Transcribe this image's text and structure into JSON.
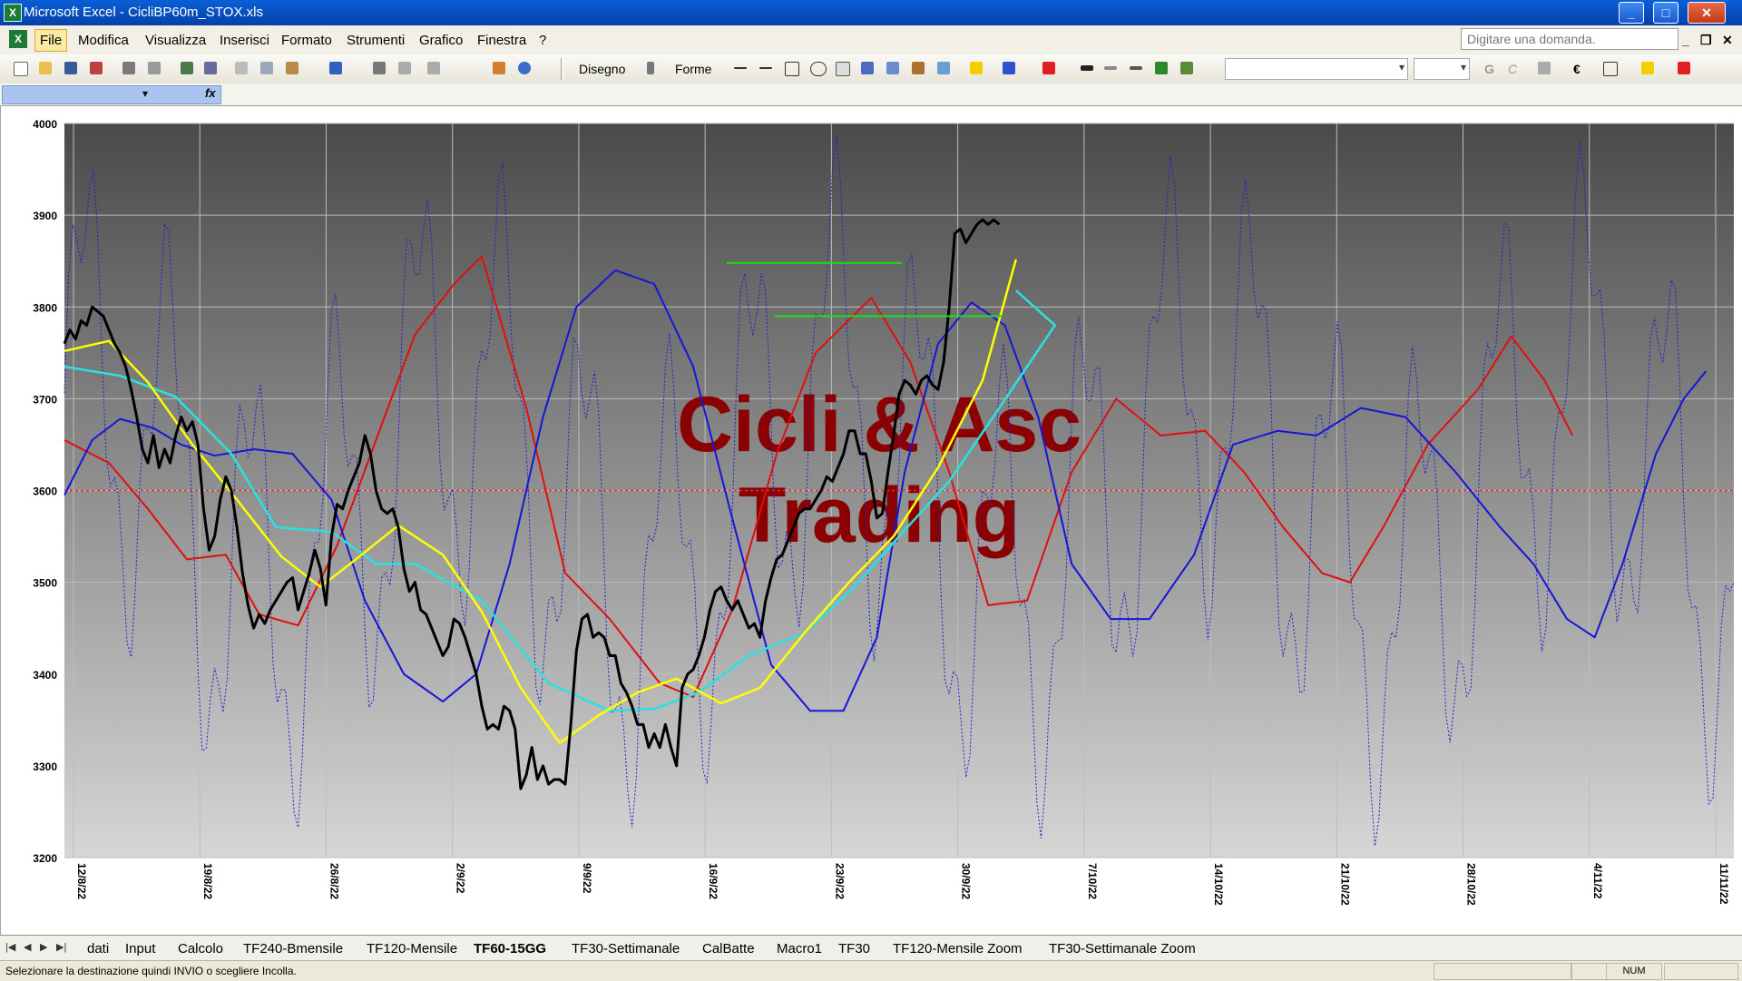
{
  "window": {
    "title": "Microsoft Excel - CicliBP60m_STOX.xls"
  },
  "menu": [
    "File",
    "Modifica",
    "Visualizza",
    "Inserisci",
    "Formato",
    "Strumenti",
    "Grafico",
    "Finestra",
    "?"
  ],
  "ask_placeholder": "Digitare una domanda.",
  "toolbar": {
    "draw_label": "Disegno",
    "shapes_label": "Forme",
    "bold_label": "G",
    "italic_label": "C",
    "euro_label": "€"
  },
  "formula": {
    "fx_label": "fx"
  },
  "chart_data": {
    "type": "line",
    "ylim": [
      3200,
      4000
    ],
    "ytick_labels": [
      "4000",
      "3900",
      "3800",
      "3700",
      "3600",
      "3500",
      "3400",
      "3300",
      "3200"
    ],
    "x_tick_labels": [
      "12/8/22",
      "19/8/22",
      "26/8/22",
      "2/9/22",
      "9/9/22",
      "16/9/22",
      "23/9/22",
      "30/9/22",
      "7/10/22",
      "14/10/22",
      "21/10/22",
      "28/10/22",
      "4/11/22",
      "11/11/22"
    ],
    "watermark": [
      "Cicli & Asc",
      "Trading"
    ],
    "reference_level": 3600,
    "colors": {
      "price": "#000000",
      "yellow": "#ffff00",
      "cyan": "#28e2e2",
      "red": "#e01010",
      "blue": "#1616d8",
      "dotted": "#2020c8",
      "green": "#18e018",
      "ref": "#e83030"
    },
    "x_range": [
      0,
      186
    ],
    "price": [
      [
        0,
        3760
      ],
      [
        2,
        3775
      ],
      [
        4,
        3765
      ],
      [
        6,
        3785
      ],
      [
        8,
        3780
      ],
      [
        10,
        3800
      ],
      [
        12,
        3795
      ],
      [
        14,
        3790
      ],
      [
        16,
        3775
      ],
      [
        18,
        3760
      ],
      [
        20,
        3750
      ],
      [
        22,
        3735
      ],
      [
        24,
        3710
      ],
      [
        26,
        3680
      ],
      [
        28,
        3645
      ],
      [
        30,
        3630
      ],
      [
        32,
        3660
      ],
      [
        34,
        3625
      ],
      [
        36,
        3645
      ],
      [
        38,
        3630
      ],
      [
        40,
        3660
      ],
      [
        42,
        3680
      ],
      [
        44,
        3665
      ],
      [
        46,
        3675
      ],
      [
        48,
        3650
      ],
      [
        50,
        3580
      ],
      [
        52,
        3535
      ],
      [
        54,
        3550
      ],
      [
        56,
        3590
      ],
      [
        58,
        3615
      ],
      [
        60,
        3600
      ],
      [
        62,
        3560
      ],
      [
        64,
        3510
      ],
      [
        66,
        3475
      ],
      [
        68,
        3450
      ],
      [
        70,
        3465
      ],
      [
        72,
        3455
      ],
      [
        74,
        3470
      ],
      [
        76,
        3480
      ],
      [
        78,
        3490
      ],
      [
        80,
        3500
      ],
      [
        82,
        3505
      ],
      [
        84,
        3470
      ],
      [
        86,
        3490
      ],
      [
        88,
        3510
      ],
      [
        90,
        3535
      ],
      [
        92,
        3515
      ],
      [
        94,
        3475
      ],
      [
        96,
        3550
      ],
      [
        98,
        3585
      ],
      [
        100,
        3580
      ],
      [
        102,
        3600
      ],
      [
        104,
        3615
      ],
      [
        106,
        3630
      ],
      [
        108,
        3660
      ],
      [
        110,
        3640
      ],
      [
        112,
        3600
      ],
      [
        114,
        3580
      ],
      [
        116,
        3575
      ],
      [
        118,
        3580
      ],
      [
        120,
        3560
      ],
      [
        122,
        3515
      ],
      [
        124,
        3490
      ],
      [
        126,
        3500
      ],
      [
        128,
        3470
      ],
      [
        130,
        3465
      ],
      [
        132,
        3450
      ],
      [
        134,
        3435
      ],
      [
        136,
        3420
      ],
      [
        138,
        3430
      ],
      [
        140,
        3460
      ],
      [
        142,
        3455
      ],
      [
        144,
        3440
      ],
      [
        146,
        3420
      ],
      [
        148,
        3400
      ],
      [
        150,
        3365
      ],
      [
        152,
        3340
      ],
      [
        154,
        3345
      ],
      [
        156,
        3340
      ],
      [
        158,
        3365
      ],
      [
        160,
        3360
      ],
      [
        162,
        3340
      ],
      [
        164,
        3275
      ],
      [
        166,
        3290
      ],
      [
        168,
        3320
      ],
      [
        170,
        3285
      ],
      [
        172,
        3300
      ],
      [
        174,
        3280
      ],
      [
        176,
        3285
      ],
      [
        178,
        3285
      ],
      [
        180,
        3280
      ],
      [
        182,
        3345
      ],
      [
        184,
        3425
      ],
      [
        186,
        3460
      ],
      [
        188,
        3465
      ],
      [
        190,
        3440
      ],
      [
        192,
        3445
      ],
      [
        194,
        3440
      ],
      [
        196,
        3420
      ],
      [
        198,
        3420
      ],
      [
        200,
        3390
      ],
      [
        202,
        3380
      ],
      [
        204,
        3365
      ],
      [
        206,
        3345
      ],
      [
        208,
        3345
      ],
      [
        210,
        3320
      ],
      [
        212,
        3335
      ],
      [
        214,
        3320
      ],
      [
        216,
        3345
      ],
      [
        218,
        3320
      ],
      [
        220,
        3300
      ],
      [
        222,
        3385
      ],
      [
        224,
        3400
      ],
      [
        226,
        3405
      ],
      [
        228,
        3420
      ],
      [
        230,
        3440
      ],
      [
        232,
        3470
      ],
      [
        234,
        3490
      ],
      [
        236,
        3495
      ],
      [
        238,
        3480
      ],
      [
        240,
        3470
      ],
      [
        242,
        3480
      ],
      [
        244,
        3465
      ],
      [
        246,
        3450
      ],
      [
        248,
        3455
      ],
      [
        250,
        3440
      ],
      [
        252,
        3480
      ],
      [
        254,
        3505
      ],
      [
        256,
        3525
      ],
      [
        258,
        3530
      ],
      [
        260,
        3545
      ],
      [
        262,
        3560
      ],
      [
        264,
        3575
      ],
      [
        266,
        3580
      ],
      [
        268,
        3580
      ],
      [
        270,
        3590
      ],
      [
        272,
        3600
      ],
      [
        274,
        3615
      ],
      [
        276,
        3610
      ],
      [
        278,
        3625
      ],
      [
        280,
        3640
      ],
      [
        282,
        3665
      ],
      [
        284,
        3665
      ],
      [
        286,
        3640
      ],
      [
        288,
        3640
      ],
      [
        290,
        3610
      ],
      [
        292,
        3570
      ],
      [
        294,
        3575
      ],
      [
        296,
        3620
      ],
      [
        298,
        3660
      ],
      [
        300,
        3705
      ],
      [
        302,
        3720
      ],
      [
        304,
        3715
      ],
      [
        306,
        3705
      ],
      [
        308,
        3720
      ],
      [
        310,
        3725
      ],
      [
        312,
        3715
      ],
      [
        314,
        3710
      ],
      [
        316,
        3740
      ],
      [
        318,
        3800
      ],
      [
        320,
        3880
      ],
      [
        322,
        3885
      ],
      [
        324,
        3870
      ],
      [
        326,
        3880
      ],
      [
        328,
        3890
      ],
      [
        330,
        3895
      ],
      [
        332,
        3890
      ],
      [
        334,
        3895
      ],
      [
        336,
        3890
      ]
    ],
    "yellow": [
      [
        0,
        3752
      ],
      [
        16,
        3763
      ],
      [
        30,
        3718
      ],
      [
        46,
        3650
      ],
      [
        62,
        3590
      ],
      [
        78,
        3528
      ],
      [
        92,
        3495
      ],
      [
        106,
        3528
      ],
      [
        120,
        3562
      ],
      [
        136,
        3530
      ],
      [
        150,
        3468
      ],
      [
        164,
        3385
      ],
      [
        178,
        3325
      ],
      [
        192,
        3355
      ],
      [
        206,
        3380
      ],
      [
        220,
        3395
      ],
      [
        236,
        3368
      ],
      [
        250,
        3385
      ],
      [
        266,
        3445
      ],
      [
        282,
        3500
      ],
      [
        298,
        3550
      ],
      [
        314,
        3625
      ],
      [
        330,
        3720
      ],
      [
        342,
        3852
      ]
    ],
    "cyan": [
      [
        0,
        3735
      ],
      [
        20,
        3725
      ],
      [
        40,
        3702
      ],
      [
        60,
        3640
      ],
      [
        76,
        3560
      ],
      [
        96,
        3555
      ],
      [
        112,
        3520
      ],
      [
        126,
        3520
      ],
      [
        150,
        3480
      ],
      [
        174,
        3390
      ],
      [
        196,
        3360
      ],
      [
        212,
        3362
      ],
      [
        228,
        3380
      ],
      [
        246,
        3420
      ],
      [
        266,
        3445
      ],
      [
        284,
        3495
      ],
      [
        300,
        3550
      ],
      [
        318,
        3610
      ],
      [
        336,
        3690
      ],
      [
        356,
        3780
      ],
      [
        342,
        3818
      ]
    ],
    "red": [
      [
        0,
        3655
      ],
      [
        16,
        3630
      ],
      [
        30,
        3580
      ],
      [
        44,
        3525
      ],
      [
        58,
        3530
      ],
      [
        70,
        3465
      ],
      [
        84,
        3453
      ],
      [
        98,
        3540
      ],
      [
        112,
        3655
      ],
      [
        126,
        3770
      ],
      [
        140,
        3825
      ],
      [
        150,
        3855
      ],
      [
        166,
        3690
      ],
      [
        180,
        3510
      ],
      [
        196,
        3460
      ],
      [
        214,
        3390
      ],
      [
        226,
        3375
      ],
      [
        240,
        3470
      ],
      [
        256,
        3640
      ],
      [
        270,
        3750
      ],
      [
        290,
        3810
      ],
      [
        304,
        3740
      ],
      [
        318,
        3620
      ],
      [
        332,
        3475
      ],
      [
        346,
        3480
      ],
      [
        362,
        3620
      ],
      [
        378,
        3700
      ],
      [
        394,
        3660
      ],
      [
        410,
        3665
      ],
      [
        424,
        3620
      ],
      [
        438,
        3560
      ],
      [
        452,
        3510
      ],
      [
        462,
        3500
      ],
      [
        474,
        3560
      ],
      [
        490,
        3650
      ],
      [
        508,
        3710
      ],
      [
        520,
        3768
      ],
      [
        532,
        3720
      ],
      [
        542,
        3660
      ]
    ],
    "blue": [
      [
        0,
        3595
      ],
      [
        10,
        3655
      ],
      [
        20,
        3678
      ],
      [
        32,
        3668
      ],
      [
        42,
        3650
      ],
      [
        54,
        3638
      ],
      [
        68,
        3645
      ],
      [
        82,
        3640
      ],
      [
        96,
        3590
      ],
      [
        108,
        3480
      ],
      [
        122,
        3400
      ],
      [
        136,
        3370
      ],
      [
        148,
        3400
      ],
      [
        160,
        3520
      ],
      [
        172,
        3680
      ],
      [
        184,
        3800
      ],
      [
        198,
        3840
      ],
      [
        212,
        3825
      ],
      [
        226,
        3735
      ],
      [
        240,
        3570
      ],
      [
        254,
        3410
      ],
      [
        268,
        3360
      ],
      [
        280,
        3360
      ],
      [
        292,
        3440
      ],
      [
        302,
        3620
      ],
      [
        314,
        3760
      ],
      [
        326,
        3805
      ],
      [
        338,
        3780
      ],
      [
        350,
        3680
      ],
      [
        362,
        3520
      ],
      [
        376,
        3460
      ],
      [
        390,
        3460
      ],
      [
        406,
        3530
      ],
      [
        420,
        3650
      ],
      [
        436,
        3665
      ],
      [
        450,
        3660
      ],
      [
        466,
        3690
      ],
      [
        482,
        3680
      ],
      [
        500,
        3620
      ],
      [
        516,
        3560
      ],
      [
        528,
        3520
      ],
      [
        540,
        3460
      ],
      [
        550,
        3440
      ],
      [
        560,
        3520
      ],
      [
        572,
        3640
      ],
      [
        582,
        3700
      ],
      [
        590,
        3730
      ]
    ],
    "green_segments": [
      [
        3848,
        238,
        301
      ],
      [
        3790,
        255,
        337
      ]
    ],
    "dotted_amplitude": 380
  },
  "sheet_tabs": [
    "dati",
    "Input",
    "Calcolo",
    "TF240-Bmensile",
    "TF120-Mensile",
    "TF60-15GG",
    "TF30-Settimanale",
    "CalBatte",
    "Macro1",
    "TF30",
    "TF120-Mensile Zoom",
    "TF30-Settimanale Zoom"
  ],
  "active_tab": "TF60-15GG",
  "status": {
    "text": "Selezionare la destinazione quindi INVIO o scegliere Incolla.",
    "num": "NUM"
  }
}
